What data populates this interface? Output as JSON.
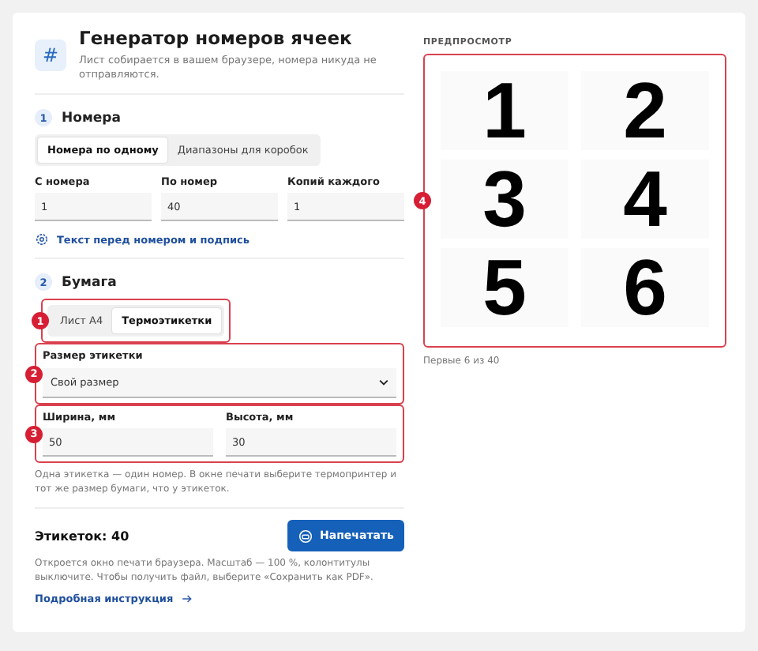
{
  "header": {
    "icon": "#",
    "title": "Генератор номеров ячеек",
    "subtitle": "Лист собирается в вашем браузере, номера никуда не отправляются."
  },
  "numbers": {
    "step": "1",
    "title": "Номера",
    "tabs": [
      {
        "label": "Номера по одному",
        "selected": true
      },
      {
        "label": "Диапазоны для коробок",
        "selected": false
      }
    ],
    "fields": [
      {
        "label": "С номера",
        "value": "1"
      },
      {
        "label": "По номер",
        "value": "40"
      },
      {
        "label": "Копий каждого",
        "value": "1"
      }
    ],
    "link": "Текст перед номером и подпись"
  },
  "paper": {
    "step": "2",
    "title": "Бумага",
    "tabs": [
      {
        "label": "Лист А4",
        "selected": false
      },
      {
        "label": "Термоэтикетки",
        "selected": true
      }
    ],
    "size_label": "Размер этикетки",
    "size_value": "Свой размер",
    "fields": [
      {
        "label": "Ширина, мм",
        "value": "50"
      },
      {
        "label": "Высота, мм",
        "value": "30"
      }
    ],
    "hint": "Одна этикетка — один номер. В окне печати выберите термопринтер и тот же размер бумаги, что у этикеток."
  },
  "summary": {
    "count": "Этикеток: 40",
    "print_button": "Напечатать",
    "note": "Откроется окно печати браузера. Масштаб — 100 %, колонтитулы выключите. Чтобы получить файл, выберите «Сохранить как PDF».",
    "link": "Подробная инструкция"
  },
  "preview": {
    "title": "ПРЕДПРОСМОТР",
    "labels": [
      "1",
      "2",
      "3",
      "4",
      "5",
      "6"
    ],
    "caption": "Первые 6 из 40"
  },
  "callouts": [
    "1",
    "2",
    "3",
    "4"
  ]
}
